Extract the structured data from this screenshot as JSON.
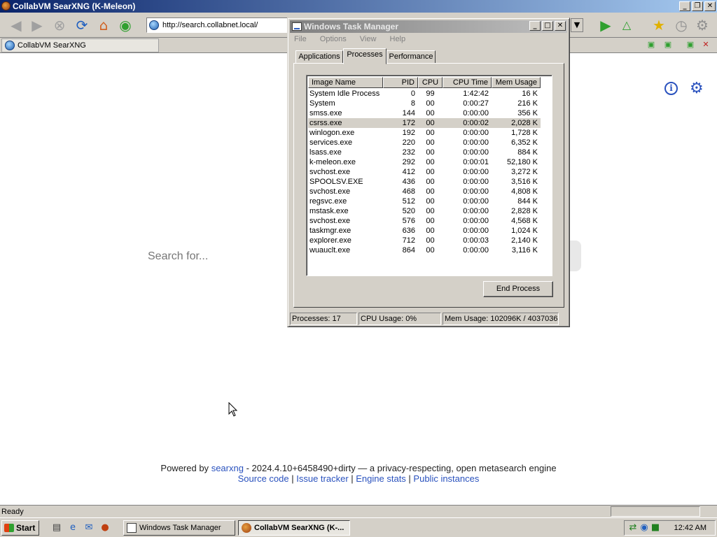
{
  "browser": {
    "title": "CollabVM SearXNG (K-Meleon)",
    "url": "http://search.collabnet.local/",
    "tab_label": "CollabVM SearXNG",
    "status": "Ready"
  },
  "page": {
    "search_placeholder": "Search for...",
    "footer_powered": "Powered by",
    "footer_searxng": "searxng",
    "footer_rest": "- 2024.4.10+6458490+dirty — a privacy-respecting, open metasearch engine",
    "links": [
      "Source code",
      "Issue tracker",
      "Engine stats",
      "Public instances"
    ]
  },
  "taskmgr": {
    "title": "Windows Task Manager",
    "menu": [
      "File",
      "Options",
      "View",
      "Help"
    ],
    "tabs": [
      "Applications",
      "Processes",
      "Performance"
    ],
    "columns": [
      "Image Name",
      "PID",
      "CPU",
      "CPU Time",
      "Mem Usage"
    ],
    "rows": [
      [
        "System Idle Process",
        "0",
        "99",
        "1:42:42",
        "16 K"
      ],
      [
        "System",
        "8",
        "00",
        "0:00:27",
        "216 K"
      ],
      [
        "smss.exe",
        "144",
        "00",
        "0:00:00",
        "356 K"
      ],
      [
        "csrss.exe",
        "172",
        "00",
        "0:00:02",
        "2,028 K"
      ],
      [
        "winlogon.exe",
        "192",
        "00",
        "0:00:00",
        "1,728 K"
      ],
      [
        "services.exe",
        "220",
        "00",
        "0:00:00",
        "6,352 K"
      ],
      [
        "lsass.exe",
        "232",
        "00",
        "0:00:00",
        "884 K"
      ],
      [
        "k-meleon.exe",
        "292",
        "00",
        "0:00:01",
        "52,180 K"
      ],
      [
        "svchost.exe",
        "412",
        "00",
        "0:00:00",
        "3,272 K"
      ],
      [
        "SPOOLSV.EXE",
        "436",
        "00",
        "0:00:00",
        "3,516 K"
      ],
      [
        "svchost.exe",
        "468",
        "00",
        "0:00:00",
        "4,808 K"
      ],
      [
        "regsvc.exe",
        "512",
        "00",
        "0:00:00",
        "844 K"
      ],
      [
        "mstask.exe",
        "520",
        "00",
        "0:00:00",
        "2,828 K"
      ],
      [
        "svchost.exe",
        "576",
        "00",
        "0:00:00",
        "4,568 K"
      ],
      [
        "taskmgr.exe",
        "636",
        "00",
        "0:00:00",
        "1,024 K"
      ],
      [
        "explorer.exe",
        "712",
        "00",
        "0:00:03",
        "2,140 K"
      ],
      [
        "wuauclt.exe",
        "864",
        "00",
        "0:00:00",
        "3,116 K"
      ]
    ],
    "selected_row": 3,
    "end_process": "End Process",
    "status_processes": "Processes: 17",
    "status_cpu": "CPU Usage: 0%",
    "status_mem": "Mem Usage: 102096K / 4037036K"
  },
  "taskbar": {
    "start": "Start",
    "tasks": [
      "Windows Task Manager",
      "CollabVM SearXNG (K-..."
    ],
    "clock": "12:42 AM"
  }
}
